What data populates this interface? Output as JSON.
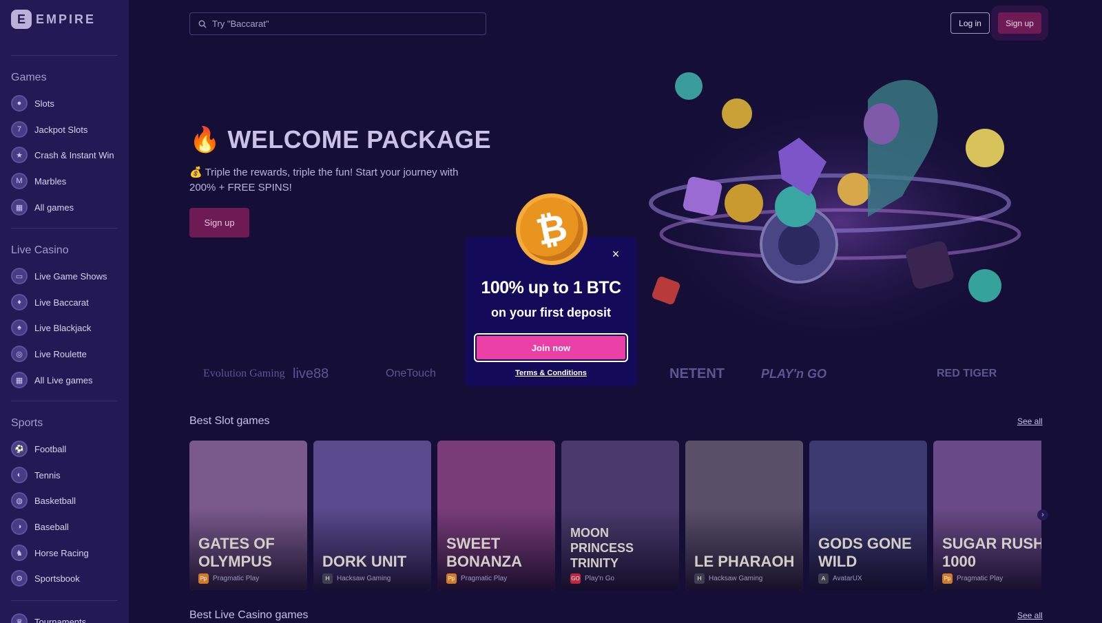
{
  "brand": {
    "name": "EMPIRE",
    "mark": "E"
  },
  "sidebar": {
    "sections": [
      {
        "title": "Games",
        "items": [
          "Slots",
          "Jackpot Slots",
          "Crash & Instant Win",
          "Marbles",
          "All games"
        ]
      },
      {
        "title": "Live Casino",
        "items": [
          "Live Game Shows",
          "Live Baccarat",
          "Live Blackjack",
          "Live Roulette",
          "All Live games"
        ]
      },
      {
        "title": "Sports",
        "items": [
          "Football",
          "Tennis",
          "Basketball",
          "Baseball",
          "Horse Racing",
          "Sportsbook"
        ]
      }
    ],
    "extra_item": "Tournaments"
  },
  "header": {
    "search_placeholder": "Try \"Baccarat\"",
    "login_label": "Log in",
    "signup_label": "Sign up"
  },
  "hero": {
    "emoji": "🔥",
    "title": "WELCOME PACKAGE",
    "subtitle": "💰 Triple the rewards, triple the fun! Start your journey with 200% + FREE SPINS!",
    "signup_label": "Sign up"
  },
  "providers": [
    "Evolution Gaming",
    "live88",
    "OneTouch",
    "NETENT",
    "PLAY'n GO",
    "RED TIGER"
  ],
  "slots_section": {
    "title": "Best Slot games",
    "see_all": "See all",
    "games": [
      {
        "title": "Gates of Olympus",
        "provider": "Pragmatic Play",
        "bg": "#7a5a8c",
        "badge": "#d27a2a",
        "badge_text": "Pp"
      },
      {
        "title": "Dork Unit",
        "provider": "Hacksaw Gaming",
        "bg": "#5b4a8e",
        "badge": "#3e3e4e",
        "badge_text": "H"
      },
      {
        "title": "Sweet Bonanza",
        "provider": "Pragmatic Play",
        "bg": "#7a3d7a",
        "badge": "#d27a2a",
        "badge_text": "Pp"
      },
      {
        "title": "Moon Princess Trinity",
        "provider": "Play'n Go",
        "bg": "#4a3a6c",
        "badge": "#c2263f",
        "badge_text": "GO"
      },
      {
        "title": "Le Pharaoh",
        "provider": "Hacksaw Gaming",
        "bg": "#5a5068",
        "badge": "#3e3e4e",
        "badge_text": "H"
      },
      {
        "title": "Gods Gone Wild",
        "provider": "AvatarUX",
        "bg": "#3c3a70",
        "badge": "#3e3e4e",
        "badge_text": "A"
      },
      {
        "title": "Sugar Rush 1000",
        "provider": "Pragmatic Play",
        "bg": "#6a4a86",
        "badge": "#d27a2a",
        "badge_text": "Pp"
      }
    ]
  },
  "live_section": {
    "title": "Best Live Casino games",
    "see_all": "See all"
  },
  "modal": {
    "coin_symbol": "₿",
    "headline": "100% up to 1 BTC",
    "subline": "on your first deposit",
    "cta": "Join now",
    "terms": "Terms & Conditions",
    "close": "×"
  },
  "colors": {
    "bg": "#150f38",
    "sidebar": "#221955",
    "accent": "#ea3fa5",
    "brand_button": "#6e1b55"
  }
}
